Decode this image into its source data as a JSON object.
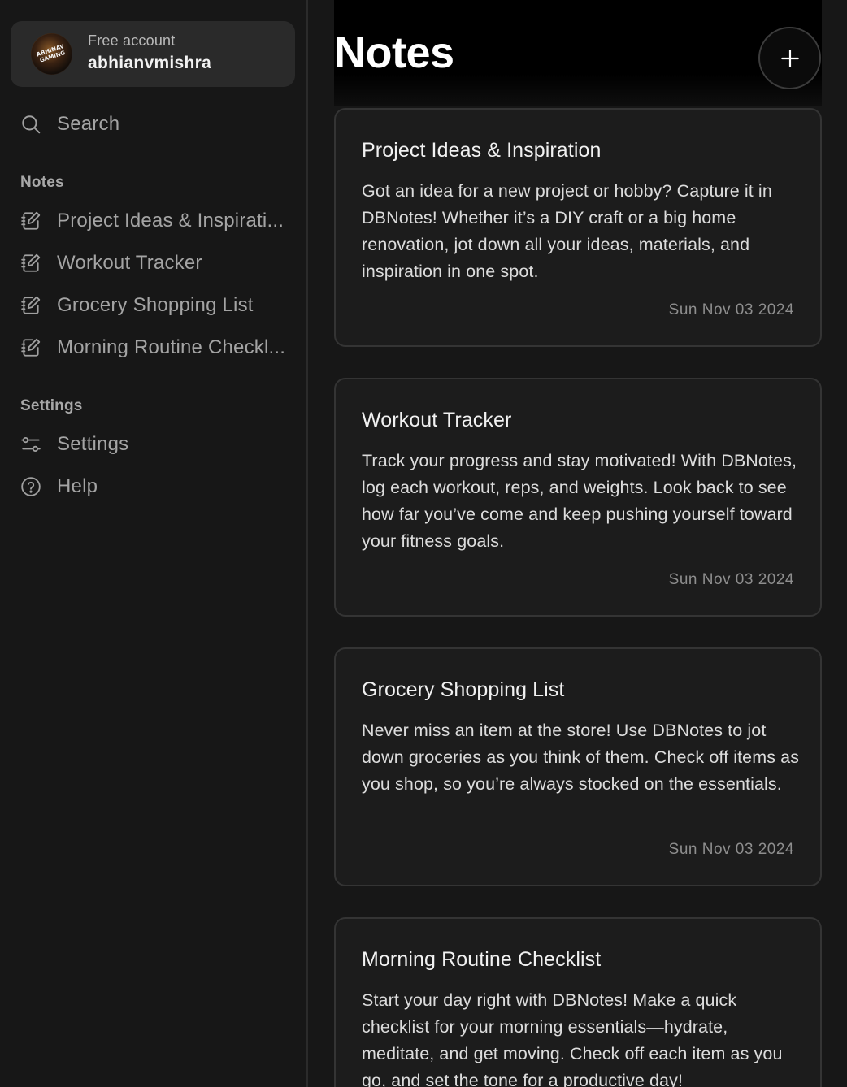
{
  "account": {
    "plan": "Free account",
    "username": "abhianvmishra",
    "avatar_text": "ABHINAV GAMING"
  },
  "search": {
    "label": "Search"
  },
  "sidebar": {
    "notes_title": "Notes",
    "notes": [
      {
        "label": "Project Ideas & Inspirati...",
        "icon": "edit-note-icon"
      },
      {
        "label": "Workout Tracker",
        "icon": "edit-note-icon"
      },
      {
        "label": "Grocery Shopping List",
        "icon": "edit-note-icon"
      },
      {
        "label": "Morning Routine Checkl...",
        "icon": "edit-note-icon"
      }
    ],
    "settings_title": "Settings",
    "settings_items": [
      {
        "label": "Settings",
        "icon": "sliders-icon"
      },
      {
        "label": "Help",
        "icon": "help-circle-icon"
      }
    ]
  },
  "main": {
    "title": "Notes",
    "add_button_icon": "plus-icon",
    "cards": [
      {
        "title": "Project Ideas & Inspiration",
        "body": "Got an idea for a new project or hobby? Capture it in DBNotes! Whether it’s a DIY craft or a big home renovation, jot down all your ideas, materials, and inspiration in one spot.",
        "date": "Sun Nov 03 2024"
      },
      {
        "title": "Workout Tracker",
        "body": "Track your progress and stay motivated! With DBNotes, log each workout, reps, and weights. Look back to see how far you’ve come and keep pushing yourself toward your fitness goals.",
        "date": "Sun Nov 03 2024"
      },
      {
        "title": "Grocery Shopping List",
        "body": "Never miss an item at the store! Use DBNotes to jot down groceries as you think of them. Check off items as you shop, so you’re always stocked on the essentials.",
        "date": "Sun Nov 03 2024"
      },
      {
        "title": "Morning Routine Checklist",
        "body": "Start your day right with DBNotes! Make a quick checklist for your morning essentials—hydrate, meditate, and get moving. Check off each item as you go, and set the tone for a productive day!",
        "date": ""
      }
    ]
  },
  "colors": {
    "background": "#171717",
    "card_background": "#1c1c1c",
    "card_border": "#343434",
    "account_background": "#2a2a2a",
    "header_background": "#000000"
  }
}
